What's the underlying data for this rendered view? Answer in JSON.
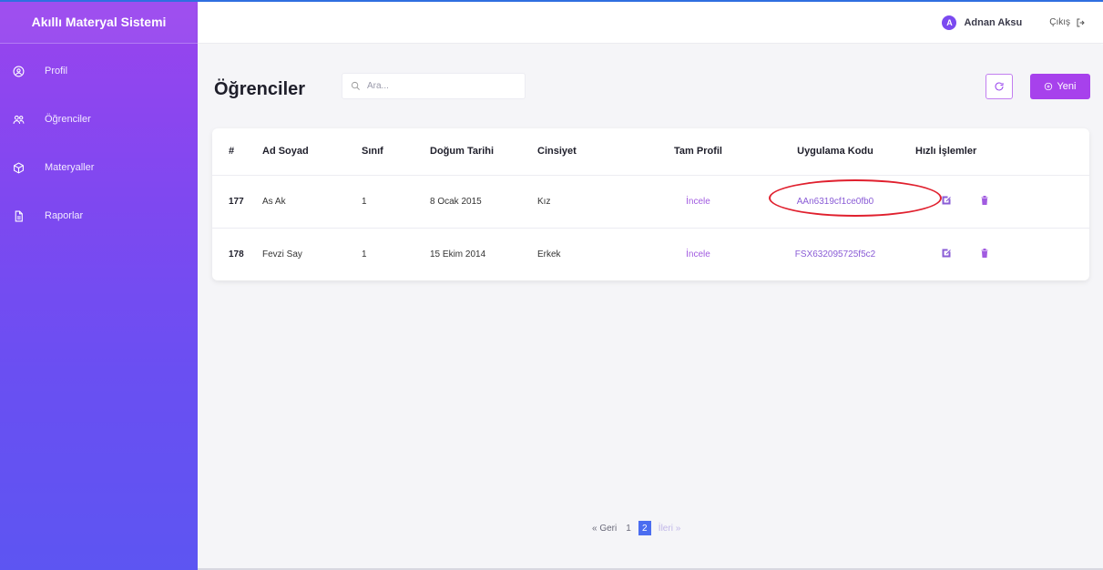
{
  "app": {
    "brand": "Akıllı Materyal Sistemi"
  },
  "sidebar": {
    "items": [
      {
        "label": "Profil",
        "icon": "user-circle-icon"
      },
      {
        "label": "Öğrenciler",
        "icon": "users-icon"
      },
      {
        "label": "Materyaller",
        "icon": "box-icon"
      },
      {
        "label": "Raporlar",
        "icon": "file-icon"
      }
    ]
  },
  "topbar": {
    "avatar_letter": "A",
    "user_name": "Adnan Aksu",
    "logout_label": "Çıkış"
  },
  "main": {
    "title": "Öğrenciler",
    "search_placeholder": "Ara...",
    "new_button": "Yeni"
  },
  "table": {
    "headers": [
      "#",
      "Ad Soyad",
      "Sınıf",
      "Doğum Tarihi",
      "Cinsiyet",
      "Tam Profil",
      "Uygulama Kodu",
      "Hızlı İşlemler"
    ],
    "rows": [
      {
        "id": "177",
        "name": "As Ak",
        "class": "1",
        "birth": "8 Ocak 2015",
        "gender": "Kız",
        "profile": "İncele",
        "code": "AAn6319cf1ce0fb0"
      },
      {
        "id": "178",
        "name": "Fevzi Say",
        "class": "1",
        "birth": "15 Ekim 2014",
        "gender": "Erkek",
        "profile": "İncele",
        "code": "FSX632095725f5c2"
      }
    ]
  },
  "pagination": {
    "prev": "« Geri",
    "pages": [
      "1",
      "2"
    ],
    "current": "2",
    "next": "İleri »"
  },
  "colors": {
    "accent": "#a741ec",
    "sidebar_top": "#9a44ee",
    "sidebar_bottom": "#5d55f2",
    "highlight": "#e0202e"
  }
}
